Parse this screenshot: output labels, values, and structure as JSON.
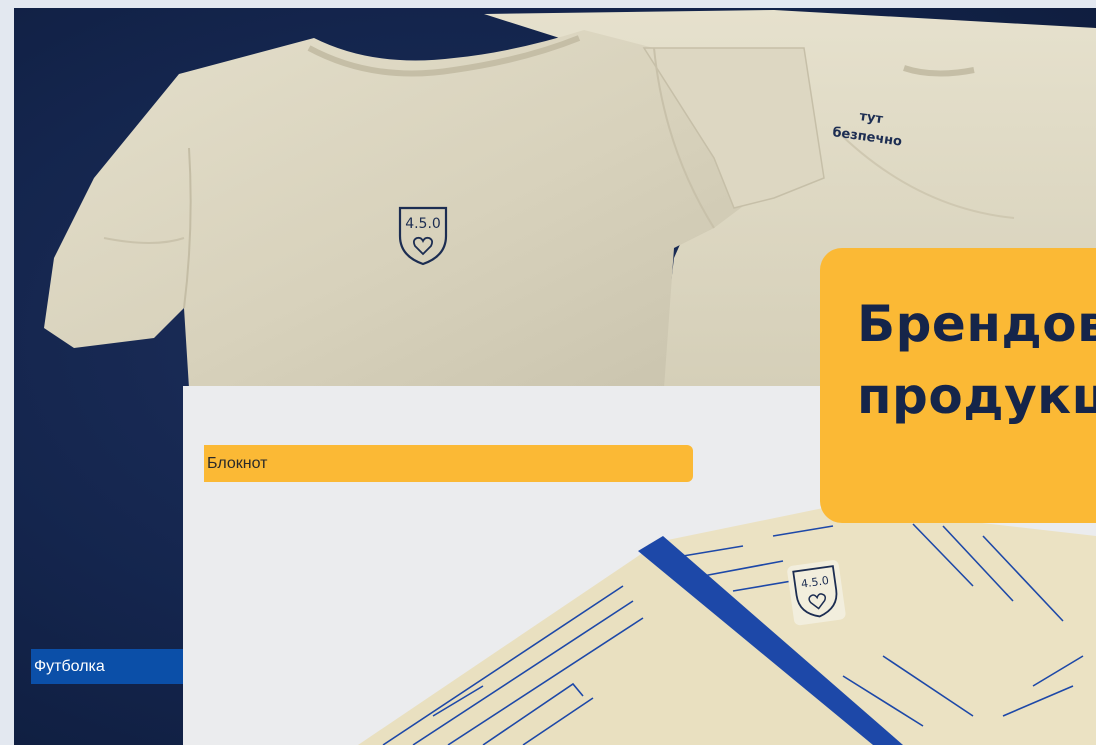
{
  "title_card": {
    "line1": "Брендована",
    "line2": "продукція"
  },
  "tshirt": {
    "label": "Футболка",
    "print_text_line1": "тут",
    "print_text_line2": "безпечно",
    "logo_text": "4.5.0"
  },
  "notebook": {
    "label": "Блокнот",
    "logo_text": "4.5.0"
  },
  "colors": {
    "accent_yellow": "#fbb935",
    "navy": "#15254a",
    "tag_blue": "#0b4fa8",
    "shirt_beige": "#ddd7c2",
    "notebook_spine": "#1d48a8"
  }
}
